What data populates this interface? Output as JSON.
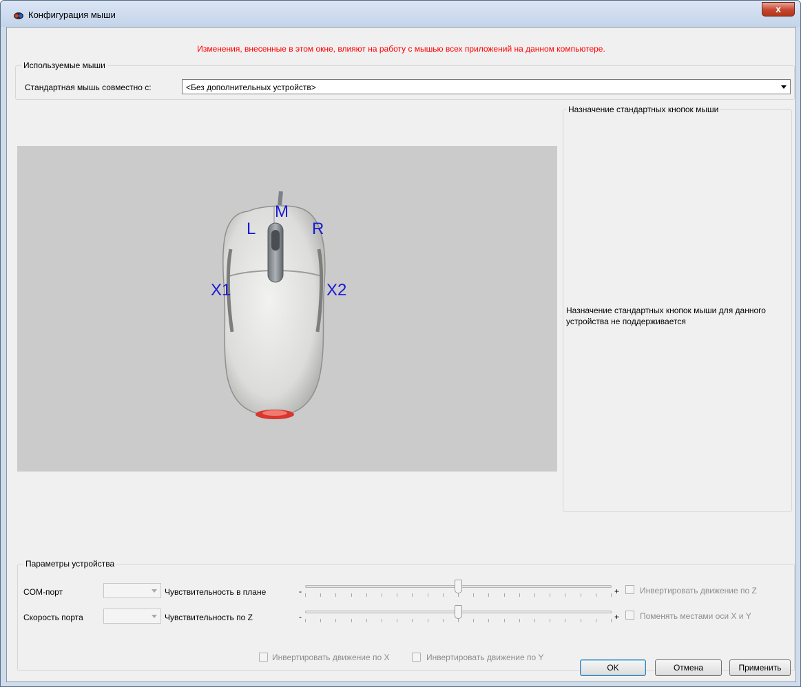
{
  "window": {
    "title": "Конфигурация мыши",
    "close_label": "x"
  },
  "warning": "Изменения, внесенные в этом окне, влияют на работу с мышью всех приложений на данном компьютере.",
  "used_mice": {
    "legend": "Используемые мыши",
    "label": "Стандартная мышь совместно с:",
    "selected": "<Без дополнительных устройств>"
  },
  "mouse_image": {
    "labels": {
      "left": "L",
      "middle": "M",
      "right": "R",
      "x1": "X1",
      "x2": "X2"
    }
  },
  "button_assignment": {
    "legend": "Назначение стандартных кнопок мыши",
    "message": "Назначение стандартных кнопок мыши для данного устройства не поддерживается"
  },
  "device_params": {
    "legend": "Параметры устройства",
    "com_port_label": "COM-порт",
    "port_speed_label": "Скорость порта",
    "plan_sensitivity_label": "Чувствительность в плане",
    "z_sensitivity_label": "Чувствительность по Z",
    "minus": "-",
    "plus": "+",
    "plan_sensitivity_value": 0.5,
    "z_sensitivity_value": 0.5,
    "invert_z_label": "Инвертировать движение по Z",
    "swap_xy_label": "Поменять местами оси X и Y",
    "invert_x_label": "Инвертировать движение по X",
    "invert_y_label": "Инвертировать движение по Y"
  },
  "buttons": {
    "ok": "OK",
    "cancel": "Отмена",
    "apply": "Применить"
  },
  "colors": {
    "warning": "#ff0000",
    "mouse_labels": "#1a1ad6"
  }
}
